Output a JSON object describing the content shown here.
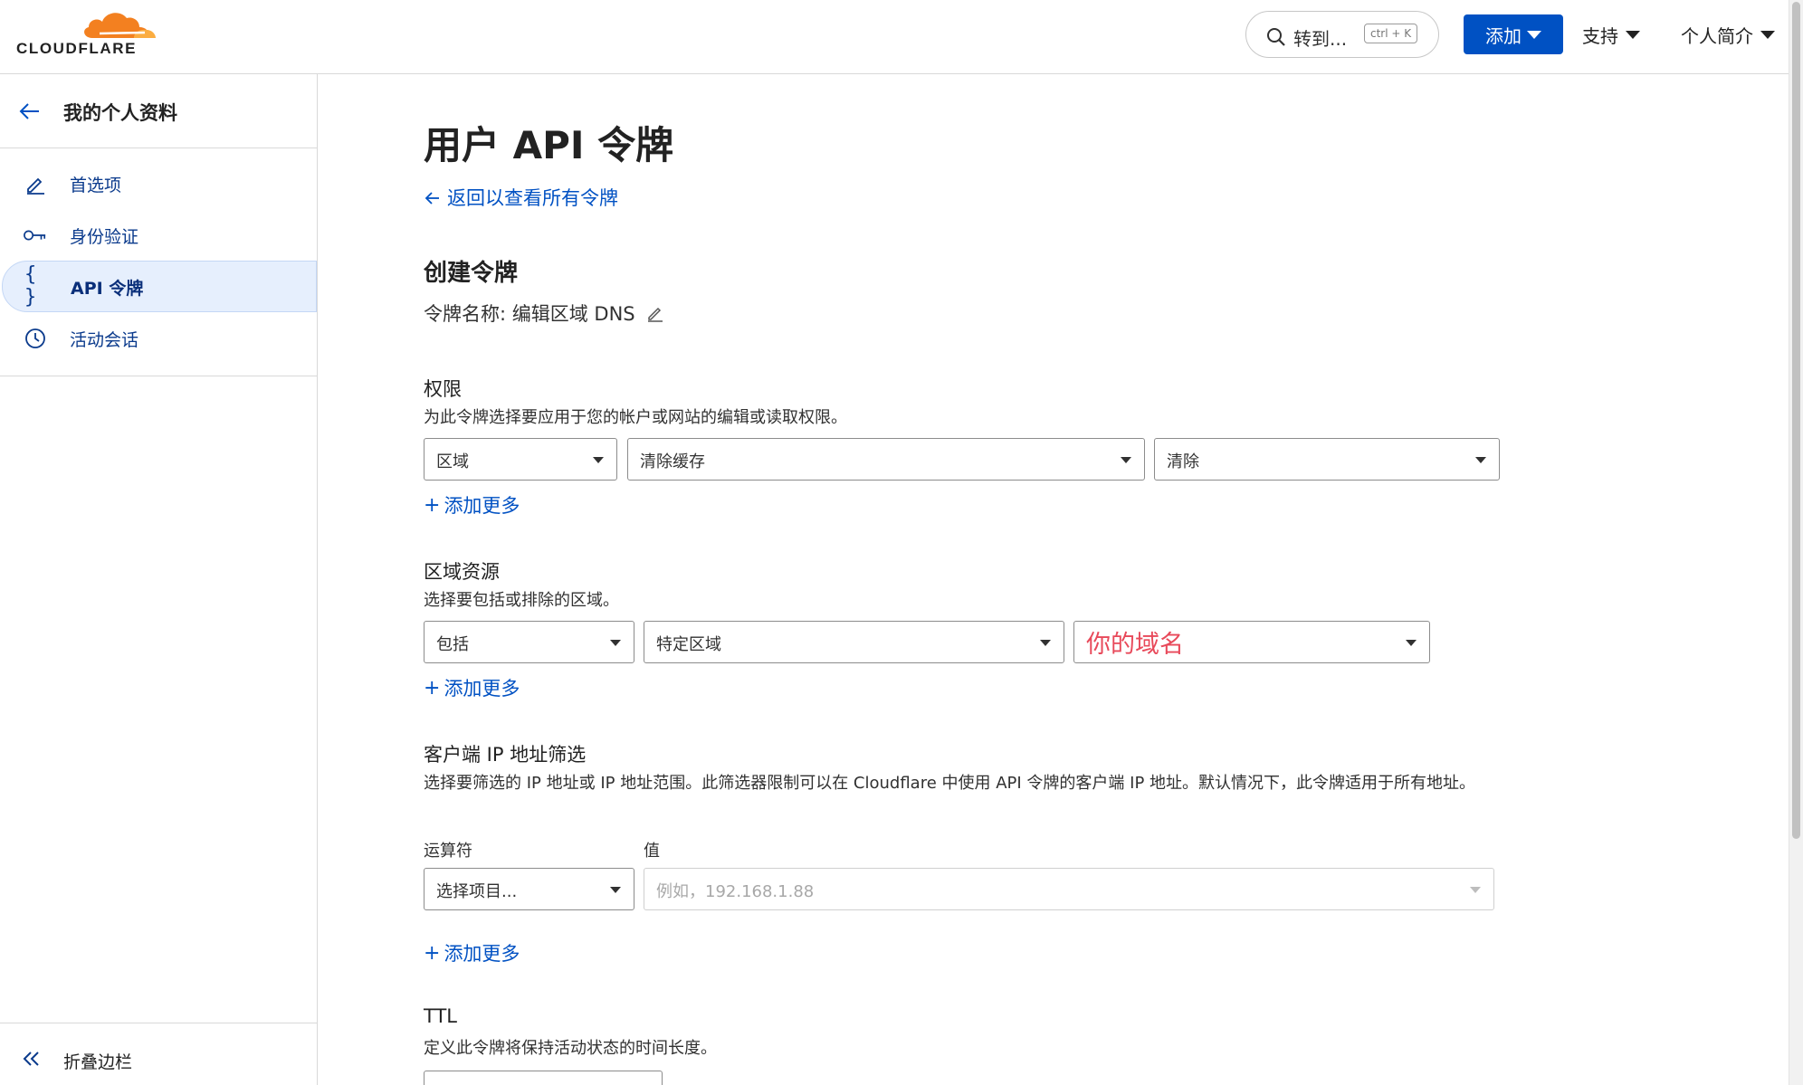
{
  "brand": {
    "logo_text": "CLOUDFLARE",
    "accent": "#f38020",
    "primary": "#0051c3"
  },
  "header": {
    "search_placeholder": "转到...",
    "search_shortcut": "ctrl + K",
    "add_label": "添加",
    "support_label": "支持",
    "profile_label": "个人简介"
  },
  "sidebar": {
    "title": "我的个人资料",
    "items": [
      {
        "label": "首选项",
        "icon": "pencil-icon"
      },
      {
        "label": "身份验证",
        "icon": "key-icon"
      },
      {
        "label": "API 令牌",
        "icon": "braces-icon",
        "active": true
      },
      {
        "label": "活动会话",
        "icon": "clock-icon"
      }
    ],
    "collapse_label": "折叠边栏"
  },
  "main": {
    "page_title": "用户 API 令牌",
    "back_link": "返回以查看所有令牌",
    "section_title": "创建令牌",
    "token_name": "令牌名称: 编辑区域 DNS",
    "permissions": {
      "title": "权限",
      "desc": "为此令牌选择要应用于您的帐户或网站的编辑或读取权限。",
      "select1": "区域",
      "select2": "清除缓存",
      "select3": "清除",
      "add_more": "添加更多"
    },
    "zone_resources": {
      "title": "区域资源",
      "desc": "选择要包括或排除的区域。",
      "select1": "包括",
      "select2": "特定区域",
      "select3": "你的域名",
      "add_more": "添加更多"
    },
    "ip_filter": {
      "title": "客户端 IP 地址筛选",
      "desc": "选择要筛选的 IP 地址或 IP 地址范围。此筛选器限制可以在 Cloudflare 中使用 API 令牌的客户端 IP 地址。默认情况下，此令牌适用于所有地址。",
      "operator_label": "运算符",
      "value_label": "值",
      "operator_value": "选择项目...",
      "value_placeholder": "例如，192.168.1.88",
      "add_more": "添加更多"
    },
    "ttl": {
      "title": "TTL",
      "desc": "定义此令牌将保持活动状态的时间长度。"
    }
  }
}
